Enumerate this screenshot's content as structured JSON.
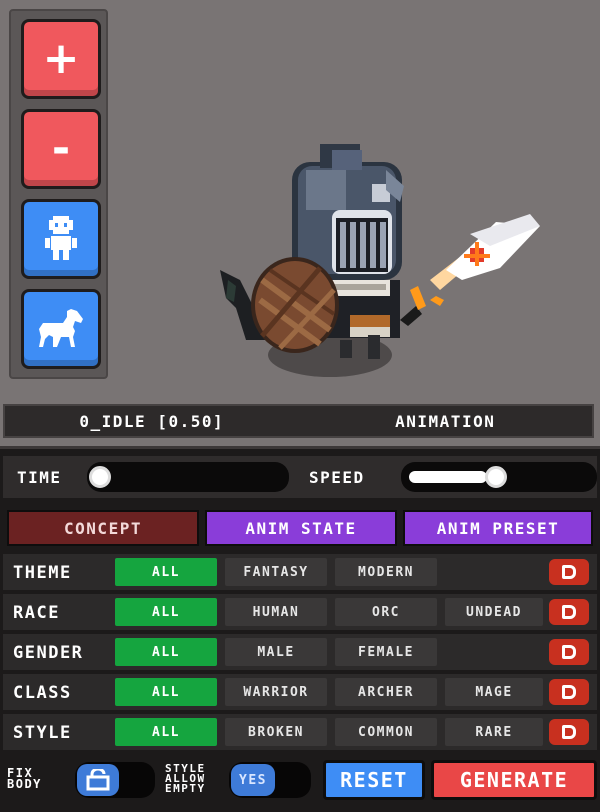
{
  "toolbar": {
    "zoom_in_label": "+",
    "zoom_out_label": "-",
    "buttons": [
      "zoom-in",
      "zoom-out",
      "character",
      "mount"
    ]
  },
  "animation_bar": {
    "current": "0_IDLE [0.50]",
    "label": "ANIMATION"
  },
  "sliders": {
    "time_label": "TIME",
    "time_value": 0.0,
    "speed_label": "SPEED",
    "speed_value": 0.5
  },
  "tabs": [
    "CONCEPT",
    "ANIM STATE",
    "ANIM PRESET"
  ],
  "filters": [
    {
      "label": "THEME",
      "options": [
        "ALL",
        "FANTASY",
        "MODERN"
      ],
      "selected": "ALL"
    },
    {
      "label": "RACE",
      "options": [
        "ALL",
        "HUMAN",
        "ORC",
        "UNDEAD"
      ],
      "selected": "ALL"
    },
    {
      "label": "GENDER",
      "options": [
        "ALL",
        "MALE",
        "FEMALE"
      ],
      "selected": "ALL"
    },
    {
      "label": "CLASS",
      "options": [
        "ALL",
        "WARRIOR",
        "ARCHER",
        "MAGE"
      ],
      "selected": "ALL"
    },
    {
      "label": "STYLE",
      "options": [
        "ALL",
        "BROKEN",
        "COMMON",
        "RARE"
      ],
      "selected": "ALL"
    }
  ],
  "footer": {
    "fix_body_label": "FIX\nBODY",
    "fix_body_line1": "FIX",
    "fix_body_line2": "BODY",
    "style_allow_line1": "STYLE",
    "style_allow_line2": "ALLOW",
    "style_allow_line3": "EMPTY",
    "style_allow_value": "YES",
    "reset_label": "RESET",
    "generate_label": "GENERATE"
  },
  "colors": {
    "background": "#797474",
    "red_button": "#f0585d",
    "blue_button": "#3e8df5",
    "selected_chip": "#15a53f",
    "tab_purple": "#8a3dd9",
    "tab_concept": "#6b2222",
    "delete": "#c8301f"
  }
}
